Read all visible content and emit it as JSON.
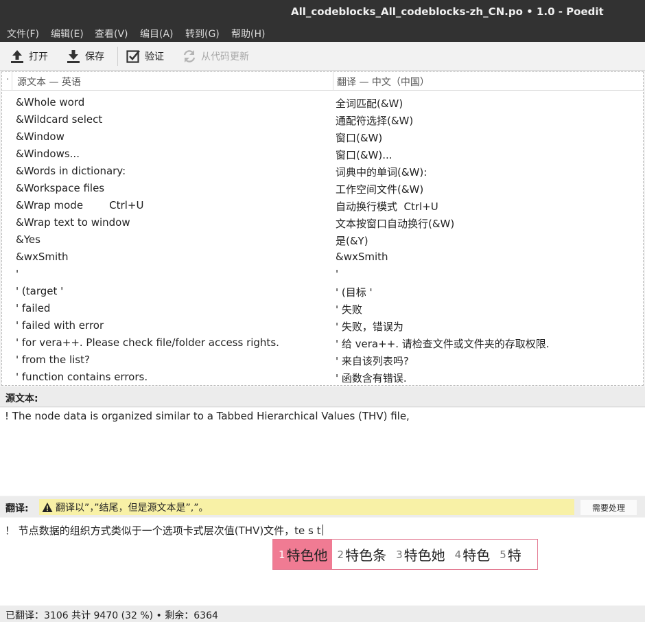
{
  "window": {
    "title": "All_codeblocks_All_codeblocks-zh_CN.po • 1.0 - Poedit"
  },
  "menu": [
    "文件(F)",
    "编辑(E)",
    "查看(V)",
    "编目(A)",
    "转到(G)",
    "帮助(H)"
  ],
  "toolbar": {
    "open": "打开",
    "save": "保存",
    "validate": "验证",
    "update": "从代码更新"
  },
  "list": {
    "header_marker": "·",
    "source_header": "源文本 — 英语",
    "translation_header": "翻译 — 中文（中国）",
    "rows": [
      {
        "source": "&Whole word",
        "translation": "全词匹配(&W)"
      },
      {
        "source": "&Wildcard select",
        "translation": "通配符选择(&W)"
      },
      {
        "source": "&Window",
        "translation": "窗口(&W)"
      },
      {
        "source": "&Windows...",
        "translation": "窗口(&W)..."
      },
      {
        "source": "&Words in dictionary:",
        "translation": "词典中的单词(&W):"
      },
      {
        "source": "&Workspace files",
        "translation": "工作空间文件(&W)"
      },
      {
        "source": "&Wrap mode        Ctrl+U",
        "translation": "自动换行模式  Ctrl+U"
      },
      {
        "source": "&Wrap text to window",
        "translation": "文本按窗口自动换行(&W)"
      },
      {
        "source": "&Yes",
        "translation": "是(&Y)"
      },
      {
        "source": "&wxSmith",
        "translation": "&wxSmith"
      },
      {
        "source": "'",
        "translation": "'"
      },
      {
        "source": "' (target '",
        "translation": "' (目标 '"
      },
      {
        "source": "' failed",
        "translation": "' 失败"
      },
      {
        "source": "' failed with error",
        "translation": "' 失败，错误为"
      },
      {
        "source": "' for vera++. Please check file/folder access rights.",
        "translation": "' 给 vera++. 请检查文件或文件夹的存取权限."
      },
      {
        "source": "' from the list?",
        "translation": "' 来自该列表吗?"
      },
      {
        "source": "' function contains errors.",
        "translation": "' 函数含有错误."
      }
    ]
  },
  "source_panel": {
    "label": "源文本:",
    "text": "! The node data is organized similar to a Tabbed Hierarchical Values (THV) file,"
  },
  "translation_panel": {
    "label": "翻译:",
    "warning": "翻译以”，”结尾，但是源文本是”,”。",
    "needs_work": "需要处理",
    "text": "！ 节点数据的组织方式类似于一个选项卡式层次值(THV)文件，te s t"
  },
  "ime": {
    "candidates": [
      {
        "num": "1",
        "word": "特色他"
      },
      {
        "num": "2",
        "word": "特色条"
      },
      {
        "num": "3",
        "word": "特色她"
      },
      {
        "num": "4",
        "word": "特色"
      },
      {
        "num": "5",
        "word": "特"
      }
    ]
  },
  "status": {
    "text": "已翻译：3106 共计 9470 (32 %)  •  剩余：6364"
  },
  "colors": {
    "titlebar": "#323232",
    "warning_bg": "#f8f1a6",
    "ime_selected": "#f07b93"
  }
}
